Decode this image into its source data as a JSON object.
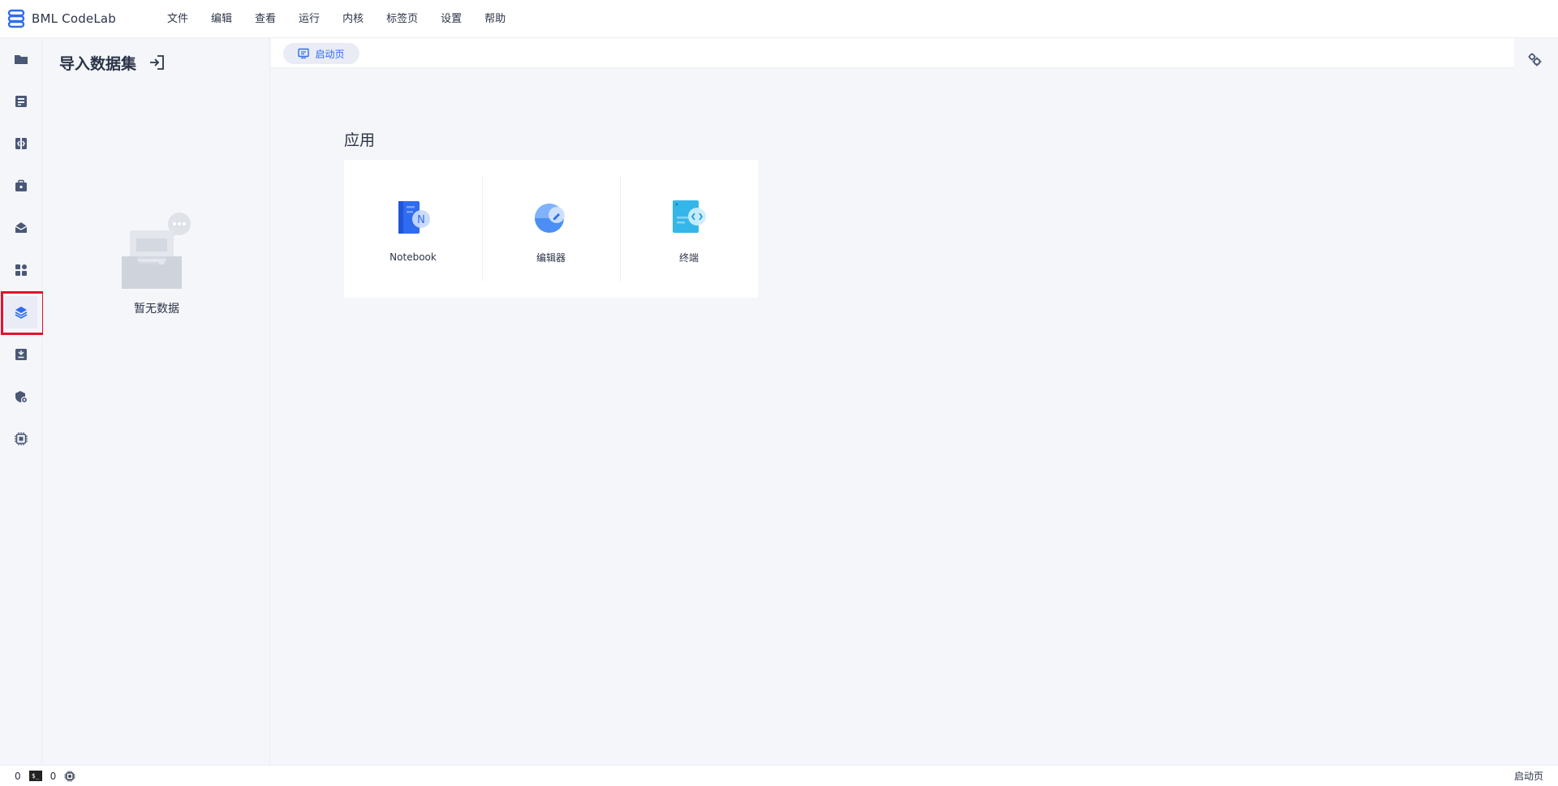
{
  "app": {
    "title": "BML CodeLab"
  },
  "menu": [
    "文件",
    "编辑",
    "查看",
    "运行",
    "内核",
    "标签页",
    "设置",
    "帮助"
  ],
  "sidebar": {
    "icons": [
      "folder-icon",
      "storage-icon",
      "code-icon",
      "toolbox-icon",
      "mail-icon",
      "apps-icon",
      "dataset-layers-icon",
      "download-icon",
      "settings-shield-icon",
      "cpu-icon"
    ],
    "active_index": 6
  },
  "panel": {
    "title": "导入数据集",
    "empty_text": "暂无数据"
  },
  "tabs": [
    {
      "label": "启动页"
    }
  ],
  "launcher": {
    "section_title": "应用",
    "items": [
      {
        "label": "Notebook",
        "icon": "notebook-icon"
      },
      {
        "label": "编辑器",
        "icon": "editor-icon"
      },
      {
        "label": "终端",
        "icon": "terminal-icon"
      }
    ]
  },
  "status": {
    "left_count": "0",
    "terminal_glyph": "$_",
    "terminal_count": "0",
    "right_label": "启动页"
  },
  "colors": {
    "accent": "#2e6bf0",
    "highlight": "#e8102c",
    "text": "#2b3447"
  }
}
